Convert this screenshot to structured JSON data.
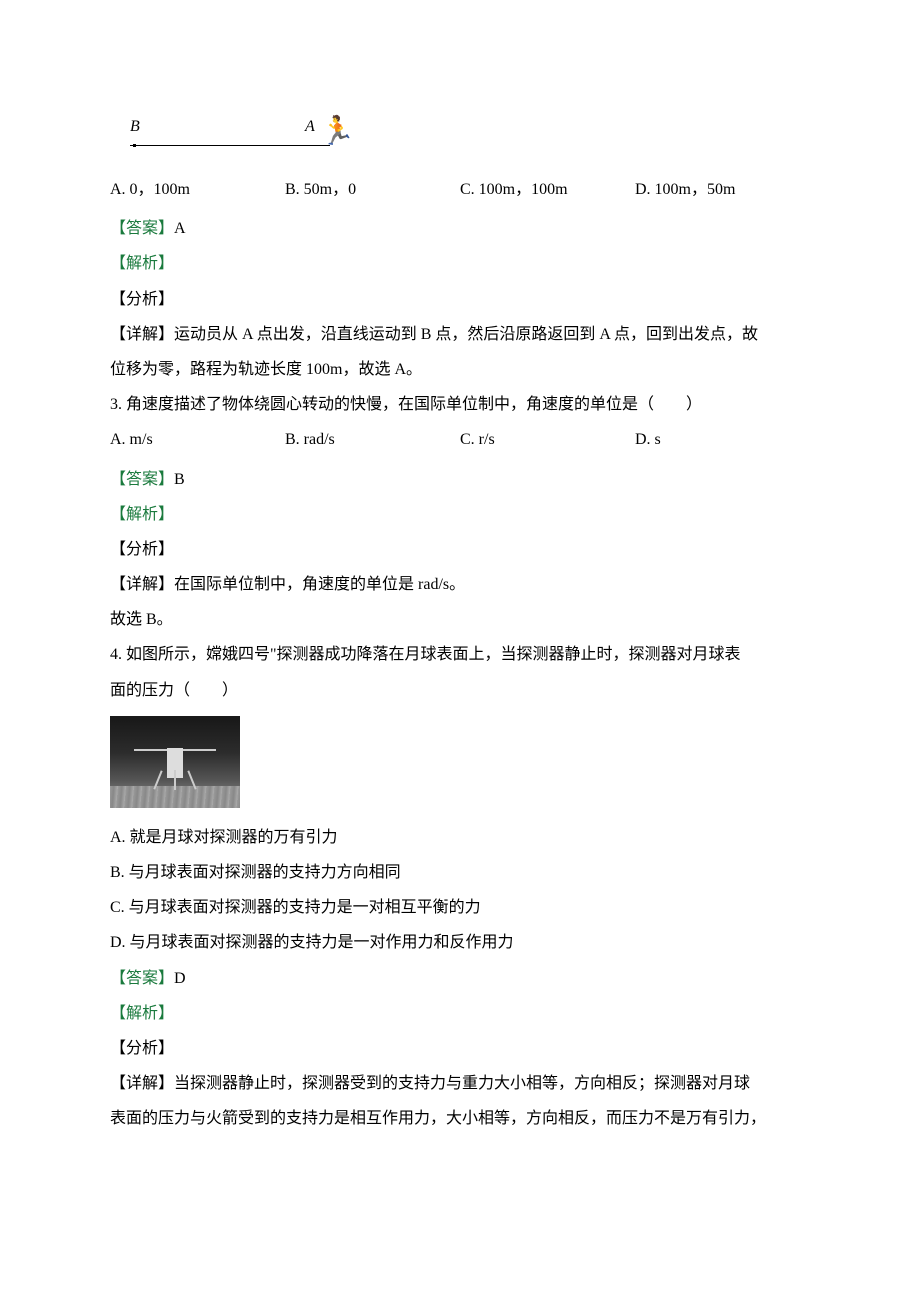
{
  "figure_runner": {
    "label_b": "B",
    "label_a": "A"
  },
  "q2": {
    "options": {
      "a": "A. 0，100m",
      "b": "B. 50m，0",
      "c": "C. 100m，100m",
      "d": "D. 100m，50m"
    },
    "answer_label": "【答案】",
    "answer_value": "A",
    "solution_label": "【解析】",
    "analysis_label": "【分析】",
    "detail_label": "【详解】",
    "detail_text_1": "运动员从 A 点出发，沿直线运动到 B 点，然后沿原路返回到 A 点，回到出发点，故",
    "detail_text_2": "位移为零，路程为轨迹长度 100m，故选 A。"
  },
  "q3": {
    "stem": "3. 角速度描述了物体绕圆心转动的快慢，在国际单位制中，角速度的单位是（　　）",
    "options": {
      "a": "A. m/s",
      "b": "B. rad/s",
      "c": "C. r/s",
      "d": "D. s"
    },
    "answer_label": "【答案】",
    "answer_value": "B",
    "solution_label": "【解析】",
    "analysis_label": "【分析】",
    "detail_label": "【详解】",
    "detail_text": "在国际单位制中，角速度的单位是 rad/s。",
    "select_line": "故选 B。"
  },
  "q4": {
    "stem_1": "4. 如图所示，嫦娥四号\"探测器成功降落在月球表面上，当探测器静止时，探测器对月球表",
    "stem_2": "面的压力（　　）",
    "options": {
      "a": "A. 就是月球对探测器的万有引力",
      "b": "B. 与月球表面对探测器的支持力方向相同",
      "c": "C. 与月球表面对探测器的支持力是一对相互平衡的力",
      "d": "D. 与月球表面对探测器的支持力是一对作用力和反作用力"
    },
    "answer_label": "【答案】",
    "answer_value": "D",
    "solution_label": "【解析】",
    "analysis_label": "【分析】",
    "detail_label": "【详解】",
    "detail_text_1": "当探测器静止时，探测器受到的支持力与重力大小相等，方向相反；探测器对月球",
    "detail_text_2": "表面的压力与火箭受到的支持力是相互作用力，大小相等，方向相反，而压力不是万有引力，"
  }
}
